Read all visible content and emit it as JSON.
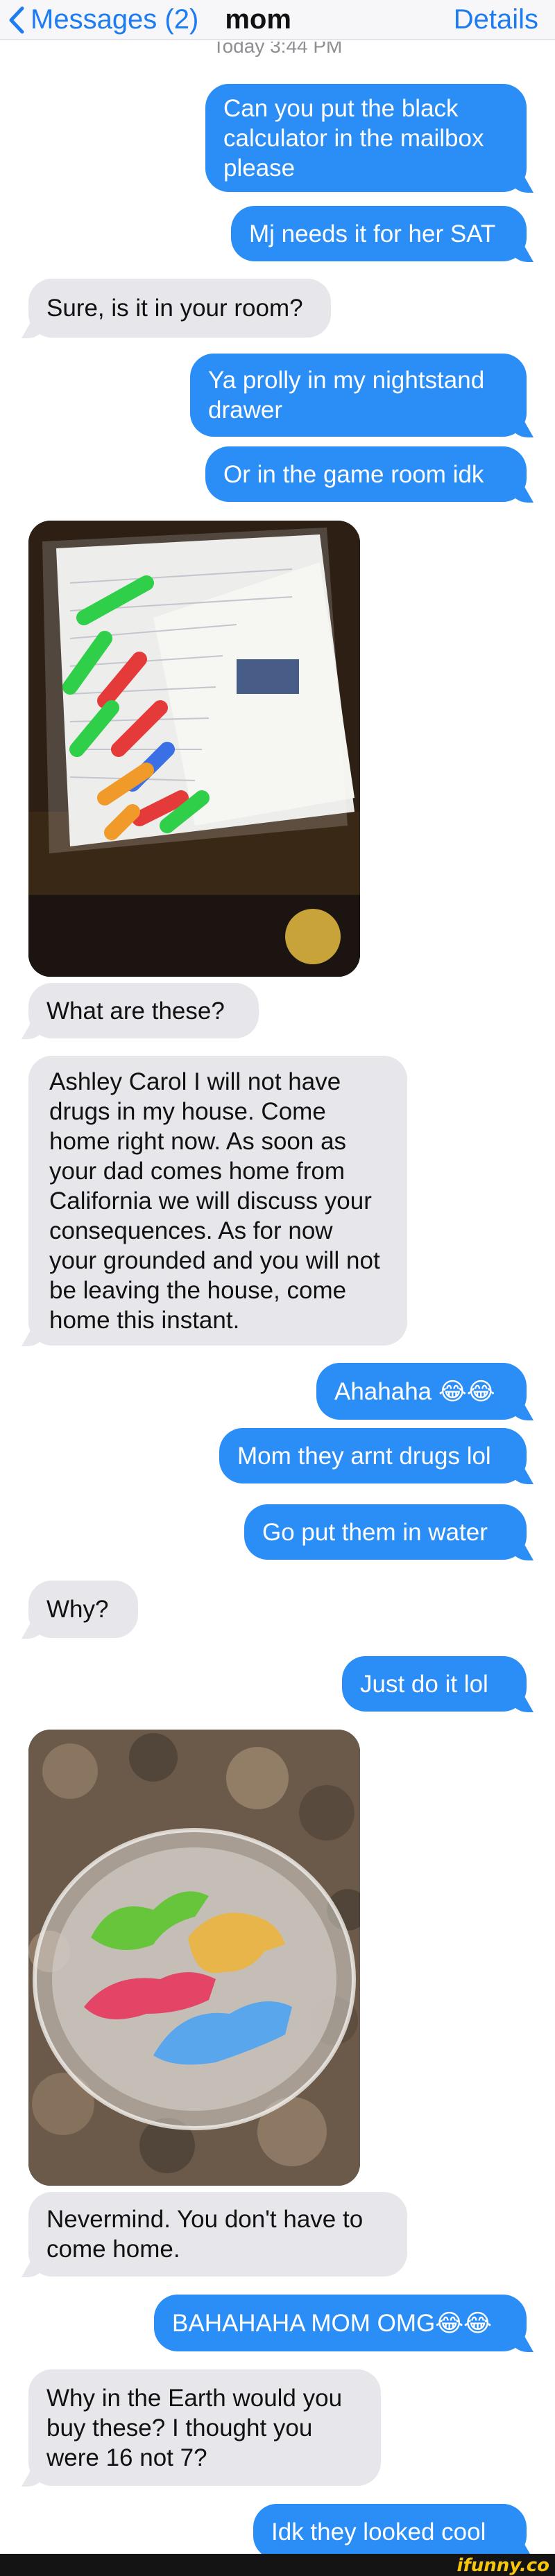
{
  "header": {
    "back_label": "Messages (2)",
    "contact": "mom",
    "details_label": "Details",
    "timestamp": "Today 3:44 PM"
  },
  "messages": [
    {
      "dir": "out",
      "text": "Can you put the black calculator in the mailbox please"
    },
    {
      "dir": "out",
      "text": "Mj needs it for her SAT"
    },
    {
      "dir": "in",
      "text": "Sure, is it in your room?"
    },
    {
      "dir": "out",
      "text": "Ya prolly in my nightstand drawer"
    },
    {
      "dir": "out",
      "text": "Or in the game room idk"
    },
    {
      "dir": "in",
      "type": "photo",
      "label": "photo of colored capsules in a plastic bag"
    },
    {
      "dir": "in",
      "text": "What are these?"
    },
    {
      "dir": "in",
      "text": "Ashley Carol I will not have drugs in my house. Come home right now. As soon as your dad comes home from California we will discuss your consequences. As for now your grounded and you will not be leaving the house, come home this instant."
    },
    {
      "dir": "out",
      "text": "Ahahaha 😂😂"
    },
    {
      "dir": "out",
      "text": "Mom they arnt drugs lol"
    },
    {
      "dir": "out",
      "text": "Go put them in water"
    },
    {
      "dir": "in",
      "text": "Why?"
    },
    {
      "dir": "out",
      "text": "Just do it lol"
    },
    {
      "dir": "in",
      "type": "photo",
      "label": "photo of foam dinosaurs in a glass bowl"
    },
    {
      "dir": "in",
      "text": "Nevermind. You don't have to come home."
    },
    {
      "dir": "out",
      "text": "BAHAHAHA MOM OMG😂😂"
    },
    {
      "dir": "in",
      "text": "Why in the Earth would you buy these? I thought you were 16 not 7?"
    },
    {
      "dir": "out",
      "text": "Idk they looked cool"
    }
  ],
  "watermark": "ifunny.co",
  "colors": {
    "accent": "#1d7cf2",
    "outgoing_bubble": "#2b8ef6",
    "incoming_bubble": "#e6e6eb",
    "watermark": "#f7c60b"
  },
  "icons": {
    "back": "chevron-left-icon"
  }
}
